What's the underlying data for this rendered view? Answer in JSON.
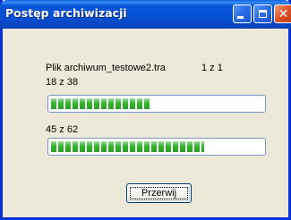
{
  "window": {
    "title": "Postęp archiwizacji",
    "controls": {
      "minimize_icon": "minimize-icon",
      "maximize_icon": "maximize-icon",
      "close_icon": "close-icon"
    },
    "colors": {
      "title_bar": "#0856d8",
      "frame": "#0831d9",
      "dialog_bg": "#ece9d8",
      "progress_fill": "#2fb52a",
      "close_button": "#e2552e"
    }
  },
  "file_line": {
    "file_label": "Plik archiwum_testowe2.tra",
    "file_counter": "1 z 1"
  },
  "progress_file": {
    "label": "18 z 38",
    "current": 18,
    "total": 38
  },
  "progress_total": {
    "label": "45 z 62",
    "current": 45,
    "total": 62
  },
  "actions": {
    "cancel_label": "Przerwij"
  }
}
